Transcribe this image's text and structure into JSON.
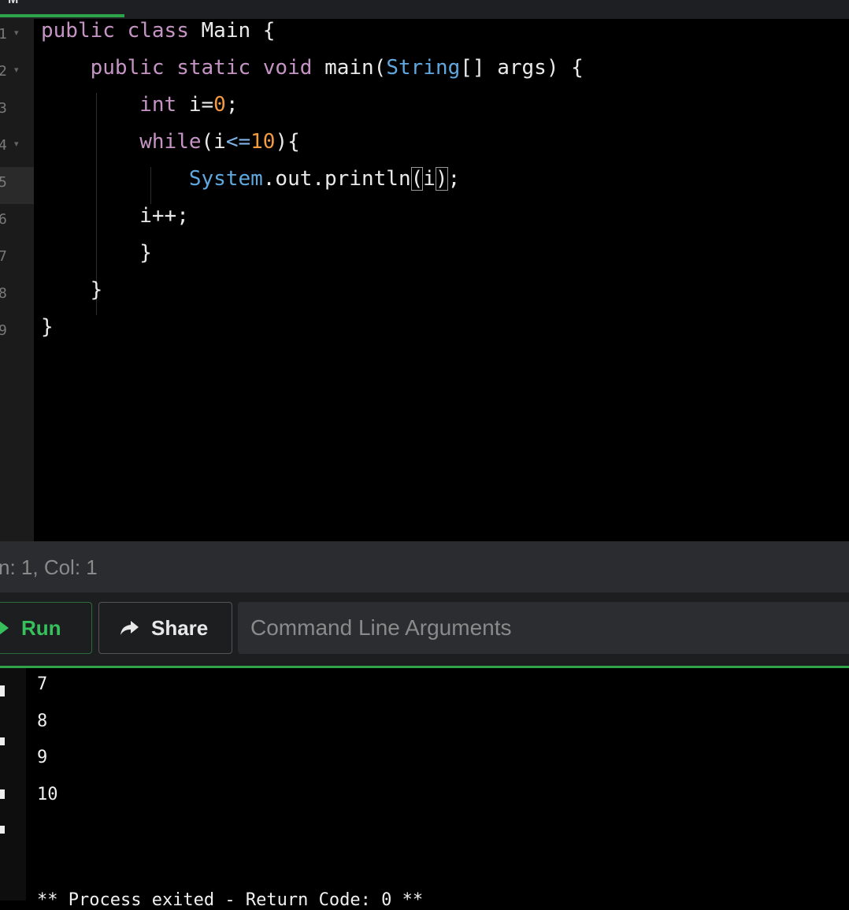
{
  "top_tab": {
    "label": "M"
  },
  "editor": {
    "line_numbers": [
      "1",
      "2",
      "3",
      "4",
      "5",
      "6",
      "7",
      "8",
      "9"
    ],
    "code": {
      "l1": {
        "kw1": "public",
        "kw2": "class",
        "name": "Main",
        "brace": "{"
      },
      "l2": {
        "kw1": "public",
        "kw2": "static",
        "kw3": "void",
        "method": "main(",
        "type": "String",
        "rest": "[] args) {"
      },
      "l3": {
        "kw": "int",
        "a": "i=",
        "num": "0",
        "b": ";"
      },
      "l4": {
        "kw": "while",
        "a": "(i",
        "op": "<=",
        "num": "10",
        "b": "){"
      },
      "l5": {
        "cls": "System",
        "a": ".out.println",
        "paren_open": "(",
        "arg": "i",
        "paren_close": ")",
        "b": ";"
      },
      "l6": {
        "a": "i++;"
      },
      "l7": {
        "a": "}"
      },
      "l8": {
        "a": "}"
      },
      "l9": {
        "a": "}"
      }
    }
  },
  "status": {
    "text": "n: 1,  Col: 1"
  },
  "toolbar": {
    "run_label": "Run",
    "share_label": "Share",
    "args_placeholder": "Command Line Arguments"
  },
  "output": {
    "lines": [
      "7",
      "8",
      "9",
      "10"
    ],
    "exit_message": "** Process exited - Return Code: 0 **"
  },
  "colors": {
    "accent": "#2fa34a",
    "run_green": "#37c15c",
    "keyword": "#c594c5",
    "class": "#5fa8e0",
    "number": "#f29b42"
  }
}
